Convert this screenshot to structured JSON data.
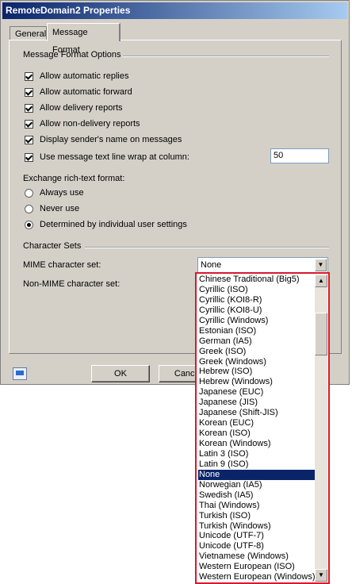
{
  "window": {
    "title": "RemoteDomain2 Properties"
  },
  "tabs": [
    {
      "label": "General"
    },
    {
      "label": "Message Format"
    }
  ],
  "message_format": {
    "group_label": "Message Format Options",
    "options": [
      {
        "label": "Allow automatic replies",
        "checked": true
      },
      {
        "label": "Allow automatic forward",
        "checked": true
      },
      {
        "label": "Allow delivery reports",
        "checked": true
      },
      {
        "label": "Allow non-delivery reports",
        "checked": true
      },
      {
        "label": "Display sender's name on messages",
        "checked": true
      },
      {
        "label": "Use message text line wrap at column:",
        "checked": true
      }
    ],
    "wrap_column_value": "50"
  },
  "rich_text": {
    "label": "Exchange rich-text format:",
    "options": [
      {
        "label": "Always use",
        "selected": false
      },
      {
        "label": "Never use",
        "selected": false
      },
      {
        "label": "Determined by individual user settings",
        "selected": true
      }
    ]
  },
  "character_sets": {
    "group_label": "Character Sets",
    "mime_label": "MIME character set:",
    "mime_value": "None",
    "non_mime_label": "Non-MIME character set:"
  },
  "dropdown_items": [
    "Chinese Traditional (Big5)",
    "Cyrillic (ISO)",
    "Cyrillic (KOI8-R)",
    "Cyrillic (KOI8-U)",
    "Cyrillic (Windows)",
    "Estonian (ISO)",
    "German (IA5)",
    "Greek (ISO)",
    "Greek (Windows)",
    "Hebrew (ISO)",
    "Hebrew (Windows)",
    "Japanese (EUC)",
    "Japanese (JIS)",
    "Japanese (Shift-JIS)",
    "Korean (EUC)",
    "Korean (ISO)",
    "Korean (Windows)",
    "Latin 3 (ISO)",
    "Latin 9 (ISO)",
    "None",
    "Norwegian (IA5)",
    "Swedish (IA5)",
    "Thai (Windows)",
    "Turkish (ISO)",
    "Turkish (Windows)",
    "Unicode (UTF-7)",
    "Unicode (UTF-8)",
    "Vietnamese (Windows)",
    "Western European (ISO)",
    "Western European (Windows)"
  ],
  "dropdown_selected": "None",
  "buttons": {
    "ok": "OK",
    "cancel": "Cancel"
  }
}
